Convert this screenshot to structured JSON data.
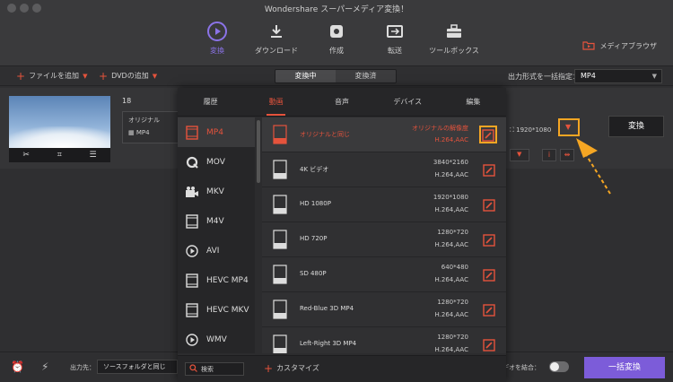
{
  "window": {
    "title": "Wondershare スーパーメディア変換！"
  },
  "toolbar": {
    "items": [
      {
        "label": "変換",
        "icon": "convert-icon",
        "active": true
      },
      {
        "label": "ダウンロード",
        "icon": "download-icon",
        "active": false
      },
      {
        "label": "作成",
        "icon": "burn-disc-icon",
        "active": false
      },
      {
        "label": "転送",
        "icon": "transfer-icon",
        "active": false
      },
      {
        "label": "ツールボックス",
        "icon": "toolbox-icon",
        "active": false
      }
    ],
    "media_browser": "メディアブラウザ",
    "accent": "#8b73e8"
  },
  "actions": {
    "add_file": "ファイルを追加",
    "add_dvd": "DVDの追加"
  },
  "tabs": {
    "converting": "変換中",
    "converted": "変換済"
  },
  "output_format": {
    "label": "出力形式を一括指定：",
    "value": "MP4"
  },
  "file": {
    "name": "18",
    "source_label": "オリジナル",
    "source_format": "MP4",
    "target_dims": "1920*1080",
    "convert_label": "変換"
  },
  "panel": {
    "tabs": [
      "履歴",
      "動画",
      "音声",
      "デバイス",
      "編集"
    ],
    "active_tab": 1,
    "formats": [
      "MP4",
      "MOV",
      "MKV",
      "M4V",
      "AVI",
      "HEVC MP4",
      "HEVC MKV",
      "WMV"
    ],
    "active_format": 0,
    "resolutions": [
      {
        "name": "オリジナルと同じ",
        "info1": "オリジナルの解像度",
        "info2": "H.264,AAC",
        "badge": "SOURCE"
      },
      {
        "name": "4K ビデオ",
        "info1": "3840*2160",
        "info2": "H.264,AAC",
        "badge": "4K"
      },
      {
        "name": "HD 1080P",
        "info1": "1920*1080",
        "info2": "H.264,AAC",
        "badge": "1080P"
      },
      {
        "name": "HD 720P",
        "info1": "1280*720",
        "info2": "H.264,AAC",
        "badge": "720P"
      },
      {
        "name": "SD 480P",
        "info1": "640*480",
        "info2": "H.264,AAC",
        "badge": "480P"
      },
      {
        "name": "Red-Blue 3D MP4",
        "info1": "1280*720",
        "info2": "H.264,AAC",
        "badge": "3D RB"
      },
      {
        "name": "Left-Right 3D MP4",
        "info1": "1280*720",
        "info2": "H.264,AAC",
        "badge": "3D LR"
      }
    ],
    "search_placeholder": "検索",
    "custom": "カスタマイズ",
    "accent": "#e5533c",
    "highlight": "#f5a623"
  },
  "bottom": {
    "output_label": "出力先：",
    "output_value": "ソースフォルダと同じ",
    "merge_label": "デオを結合：",
    "convert_all": "一括変換",
    "convert_all_color": "#7c5cd9"
  }
}
